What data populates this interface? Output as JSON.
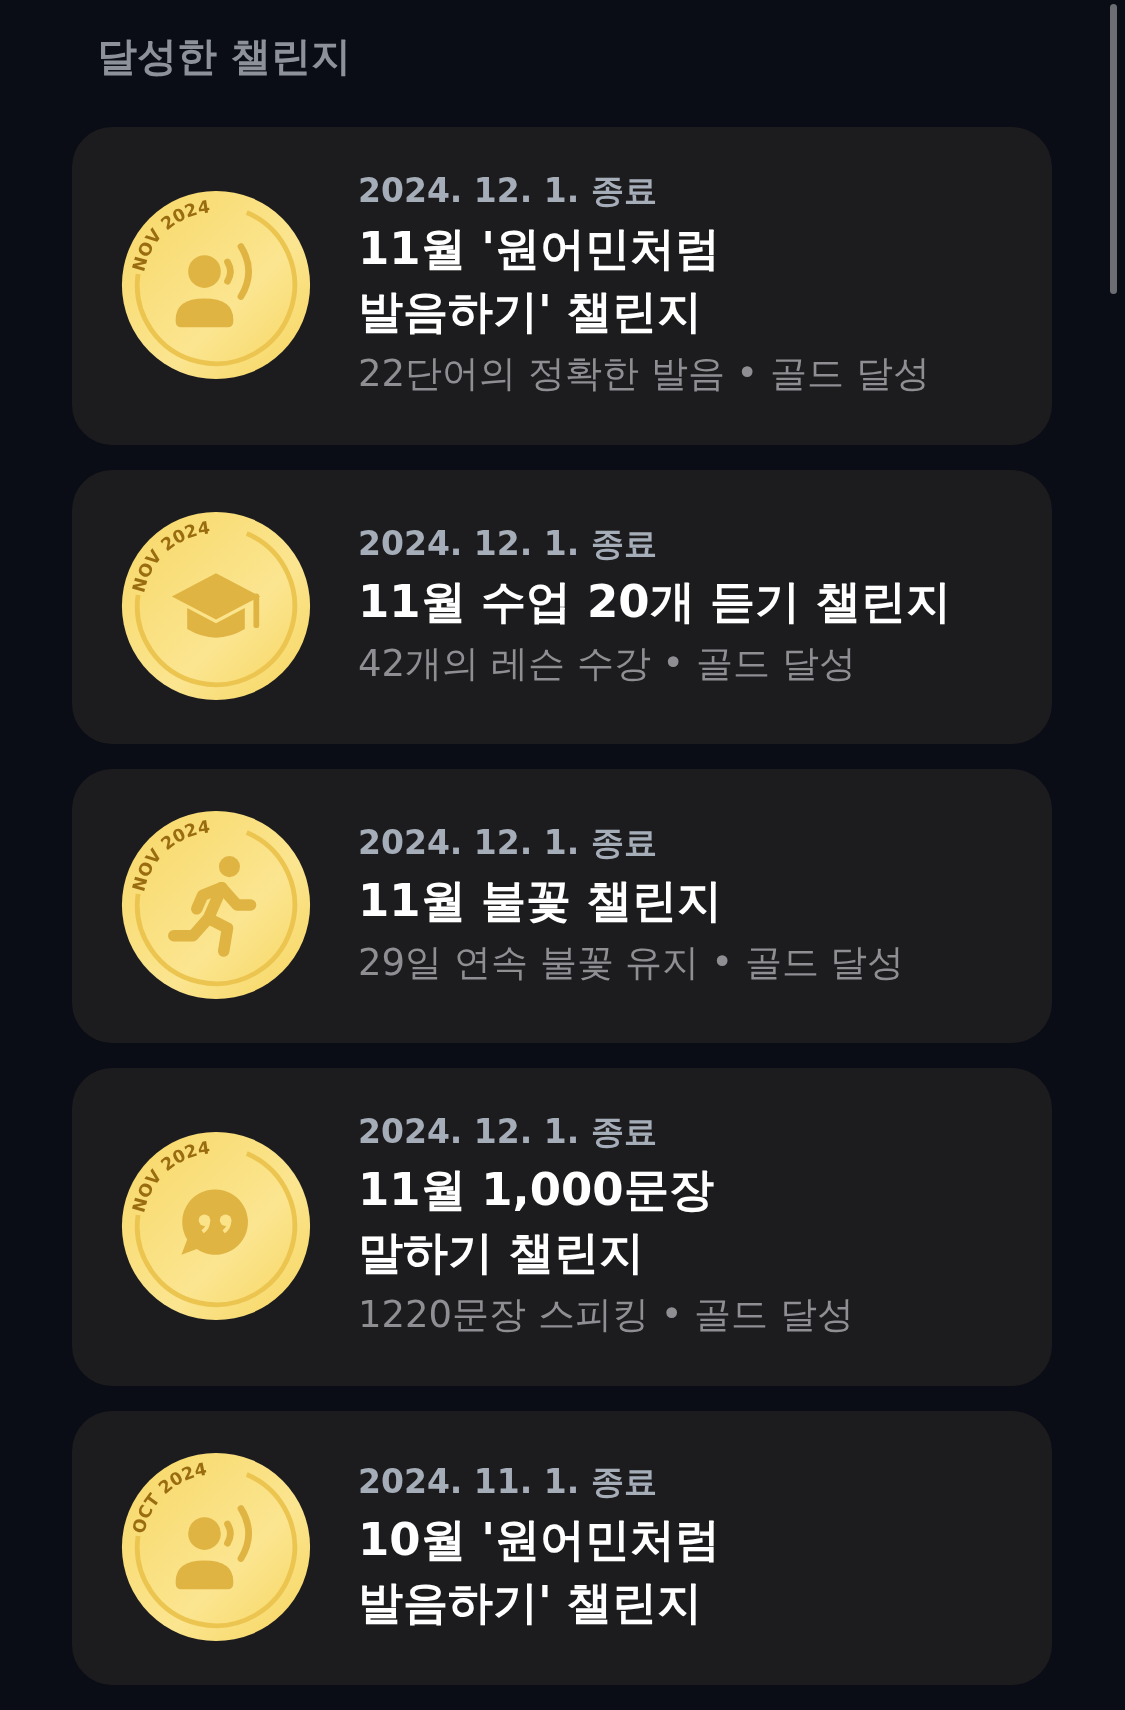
{
  "section_title": "달성한 챌린지",
  "challenges": [
    {
      "medal": {
        "label": "NOV 2024",
        "kind": "speaking"
      },
      "end_date": "2024. 12. 1. 종료",
      "title": "11월 '원어민처럼\n발음하기' 챌린지",
      "summary": "22단어의 정확한 발음 • 골드 달성"
    },
    {
      "medal": {
        "label": "NOV 2024",
        "kind": "lesson"
      },
      "end_date": "2024. 12. 1. 종료",
      "title": "11월 수업 20개 듣기 챌린지",
      "summary": "42개의 레슨 수강 • 골드 달성"
    },
    {
      "medal": {
        "label": "NOV 2024",
        "kind": "streak"
      },
      "end_date": "2024. 12. 1. 종료",
      "title": "11월 불꽃 챌린지",
      "summary": "29일 연속 불꽃 유지 • 골드 달성"
    },
    {
      "medal": {
        "label": "NOV 2024",
        "kind": "sentences"
      },
      "end_date": "2024. 12. 1. 종료",
      "title": "11월 1,000문장\n말하기 챌린지",
      "summary": "1220문장 스피킹 • 골드 달성"
    },
    {
      "medal": {
        "label": "OCT 2024",
        "kind": "speaking"
      },
      "end_date": "2024. 11. 1. 종료",
      "title": "10월 '원어민처럼\n발음하기' 챌린지"
    }
  ]
}
